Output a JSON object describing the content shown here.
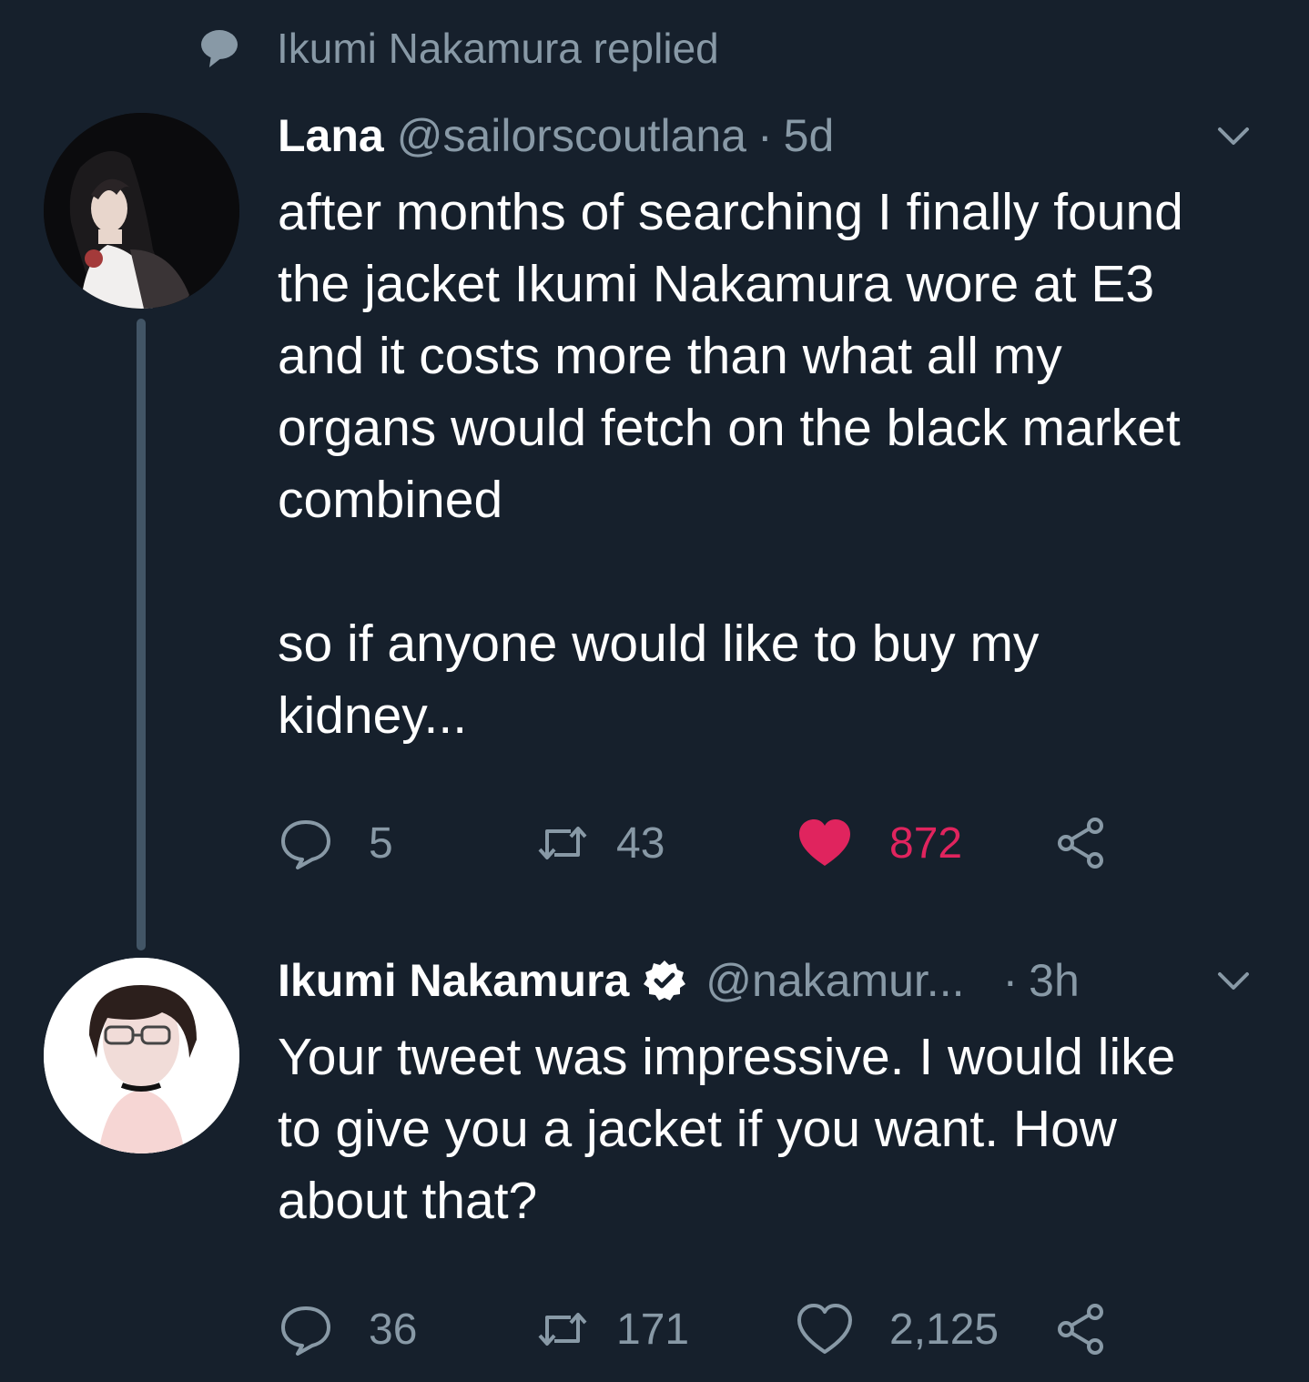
{
  "context": {
    "text": "Ikumi Nakamura replied"
  },
  "tweets": [
    {
      "display_name": "Lana",
      "handle": "@sailorscoutlana",
      "separator": "·",
      "time": "5d",
      "verified": false,
      "body": "after months of searching I finally found\nthe jacket Ikumi Nakamura wore at E3\nand it costs more than what all my\norgans would fetch on the black market\ncombined\n\nso if anyone would like to buy my\nkidney...",
      "stats": {
        "replies": "5",
        "retweets": "43",
        "likes": "872"
      },
      "liked": true
    },
    {
      "display_name": "Ikumi Nakamura",
      "handle": "@nakamur...",
      "separator": "·",
      "time": "3h",
      "verified": true,
      "body": "Your tweet was impressive. I would like\nto give you a jacket if you want. How\nabout that?",
      "stats": {
        "replies": "36",
        "retweets": "171",
        "likes": "2,125"
      },
      "liked": false
    }
  ],
  "colors": {
    "background": "#16202c",
    "secondary_text": "#8899a6",
    "like_active": "#e0245e",
    "thread_line": "#425566"
  },
  "icons": [
    "reply-bubble-icon",
    "reply-icon",
    "retweet-icon",
    "heart-icon",
    "share-icon",
    "chevron-down-icon",
    "verified-badge-icon"
  ]
}
